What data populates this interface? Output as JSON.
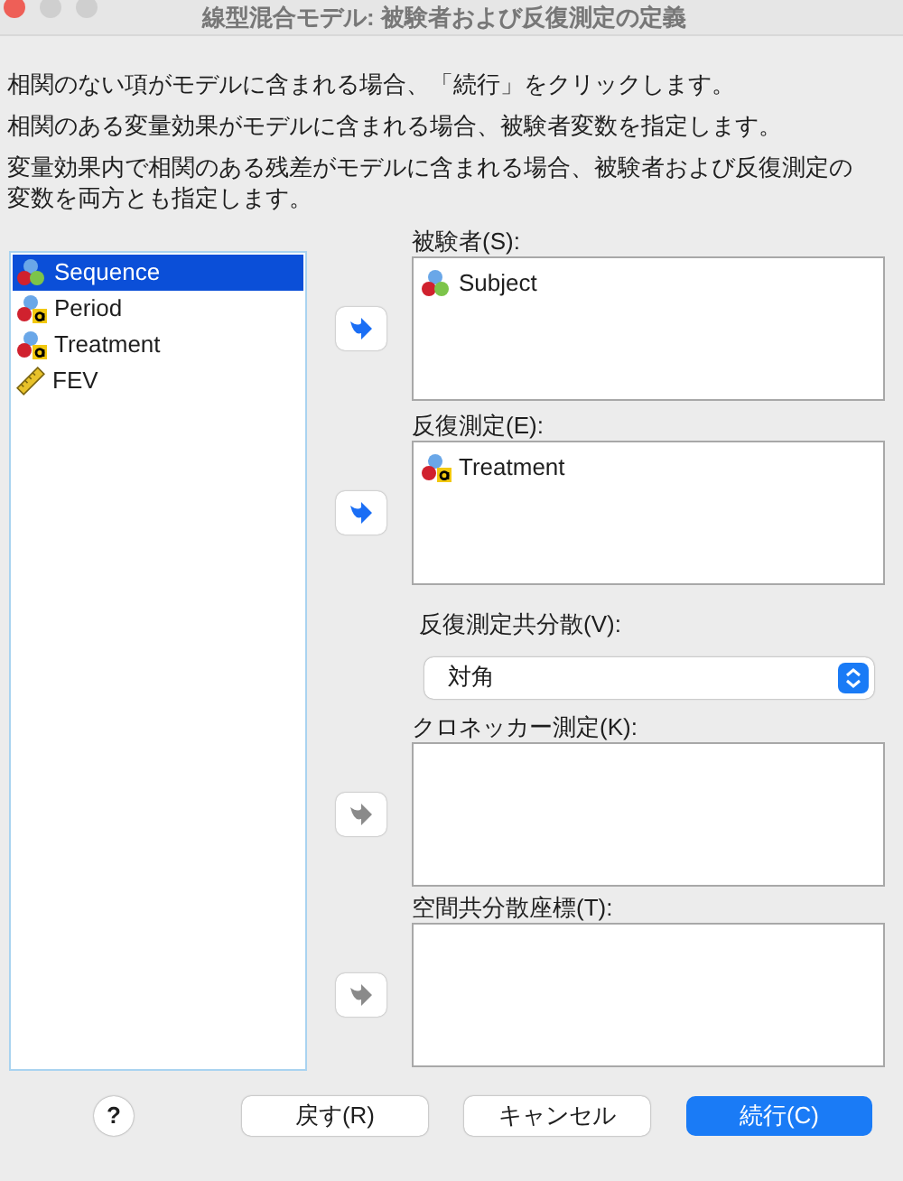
{
  "window": {
    "title": "線型混合モデル: 被験者および反復測定の定義"
  },
  "instructions": [
    "相関のない項がモデルに含まれる場合、「続行」をクリックします。",
    "相関のある変量効果がモデルに含まれる場合、被験者変数を指定します。",
    "変量効果内で相関のある残差がモデルに含まれる場合、被験者および反復測定の変数を両方とも指定します。"
  ],
  "variables": [
    {
      "name": "Sequence",
      "kind": "nominal",
      "selected": true
    },
    {
      "name": "Period",
      "kind": "nominal-string",
      "selected": false
    },
    {
      "name": "Treatment",
      "kind": "nominal-string",
      "selected": false
    },
    {
      "name": "FEV",
      "kind": "scale",
      "selected": false
    }
  ],
  "targets": [
    {
      "label": "被験者(S):",
      "arrow_disabled": false,
      "items": [
        {
          "name": "Subject",
          "kind": "nominal"
        }
      ]
    },
    {
      "label": "反復測定(E):",
      "arrow_disabled": false,
      "items": [
        {
          "name": "Treatment",
          "kind": "nominal-string"
        }
      ]
    }
  ],
  "covariance": {
    "label": "反復測定共分散(V):",
    "value": "対角"
  },
  "targets2": [
    {
      "label": "クロネッカー測定(K):",
      "arrow_disabled": true
    },
    {
      "label": "空間共分散座標(T):",
      "arrow_disabled": true
    }
  ],
  "buttons": {
    "help": "?",
    "reset": "戻す(R)",
    "cancel": "キャンセル",
    "continue": "続行(C)"
  }
}
